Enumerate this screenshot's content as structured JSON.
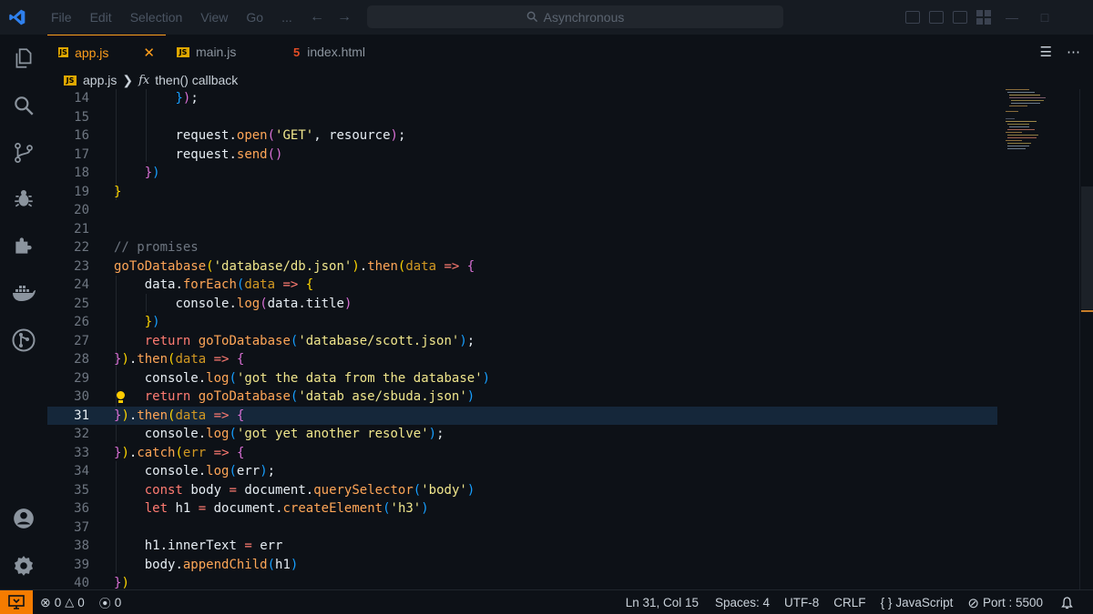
{
  "title_bar": {
    "menu": [
      "File",
      "Edit",
      "Selection",
      "View",
      "Go",
      "..."
    ],
    "search_text": "Asynchronous"
  },
  "tabs": [
    {
      "label": "app.js",
      "icon": "js-file-icon",
      "active": true
    },
    {
      "label": "main.js",
      "icon": "js-file-icon",
      "active": false
    },
    {
      "label": "index.html",
      "icon": "html5-file-icon",
      "active": false
    }
  ],
  "breadcrumb": {
    "file": "app.js",
    "symbol": "then() callback"
  },
  "editor": {
    "current_line": 31,
    "lines": [
      {
        "n": "14"
      },
      {
        "n": "15"
      },
      {
        "n": "16"
      },
      {
        "n": "17"
      },
      {
        "n": "18"
      },
      {
        "n": "19"
      },
      {
        "n": "20"
      },
      {
        "n": "21"
      },
      {
        "n": "22"
      },
      {
        "n": "23"
      },
      {
        "n": "24"
      },
      {
        "n": "25"
      },
      {
        "n": "26"
      },
      {
        "n": "27"
      },
      {
        "n": "28"
      },
      {
        "n": "29"
      },
      {
        "n": "30"
      },
      {
        "n": "31"
      },
      {
        "n": "32"
      },
      {
        "n": "33"
      },
      {
        "n": "34"
      },
      {
        "n": "35"
      },
      {
        "n": "36"
      },
      {
        "n": "37"
      },
      {
        "n": "38"
      },
      {
        "n": "39"
      },
      {
        "n": "40"
      }
    ],
    "code": {
      "l14": "});",
      "l16a": "request",
      "l16b": "open",
      "l16c": "'GET'",
      "l16d": "resource",
      "l17a": "request",
      "l17b": "send",
      "l22": "// promises",
      "l23a": "goToDatabase",
      "l23b": "'database/db.json'",
      "l23c": "then",
      "l23d": "data",
      "l24a": "data",
      "l24b": "forEach",
      "l24c": "data",
      "l25a": "console",
      "l25b": "log",
      "l25c": "data",
      "l25d": "title",
      "l27a": "return",
      "l27b": "goToDatabase",
      "l27c": "'database/scott.json'",
      "l28a": "then",
      "l28b": "data",
      "l29a": "console",
      "l29b": "log",
      "l29c": "'got the data from the database'",
      "l30a": "return",
      "l30b": "goToDatabase",
      "l30c": "'datab ase/sbuda.json'",
      "l31a": "then",
      "l31b": "data",
      "l32a": "console",
      "l32b": "log",
      "l32c": "'got yet another resolve'",
      "l33a": "catch",
      "l33b": "err",
      "l34a": "console",
      "l34b": "log",
      "l34c": "err",
      "l35a": "const",
      "l35b": "body",
      "l35c": "document",
      "l35d": "querySelector",
      "l35e": "'body'",
      "l36a": "let",
      "l36b": "h1",
      "l36c": "document",
      "l36d": "createElement",
      "l36e": "'h3'",
      "l38a": "h1",
      "l38b": "innerText",
      "l38c": "err",
      "l39a": "body",
      "l39b": "appendChild",
      "l39c": "h1"
    }
  },
  "status_bar": {
    "errors": "0",
    "warnings": "0",
    "ports": "0",
    "position": "Ln 31, Col 15",
    "spaces": "Spaces: 4",
    "encoding": "UTF-8",
    "eol": "CRLF",
    "language": "JavaScript",
    "port": "Port : 5500"
  },
  "colors": {
    "accent": "#ff9f1c",
    "background": "#0d1117",
    "remote_button": "#f57c00"
  }
}
